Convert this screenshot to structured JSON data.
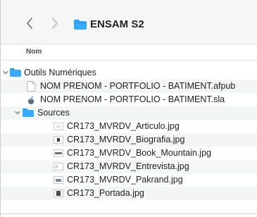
{
  "window": {
    "title": "ENSAM S2",
    "nav": {
      "back_icon": "chevron-left-icon",
      "forward_icon": "chevron-right-icon"
    }
  },
  "columns": {
    "name_header": "Nom"
  },
  "tree": [
    {
      "label": "Outils Numériques",
      "kind": "folder",
      "expanded": true,
      "level": 0
    },
    {
      "label": "NOM PRENOM - PORTFOLIO - BATIMENT.afpub",
      "kind": "file-afpub",
      "level": 1
    },
    {
      "label": "NOM PRENOM - PORTFOLIO - BATIMENT.sla",
      "kind": "file-sla",
      "level": 1
    },
    {
      "label": "Sources",
      "kind": "folder",
      "expanded": true,
      "level": 1
    },
    {
      "label": "CR173_MVRDV_Articulo.jpg",
      "kind": "image",
      "level": 2
    },
    {
      "label": "CR173_MVRDV_Biografia.jpg",
      "kind": "image",
      "level": 2
    },
    {
      "label": "CR173_MVRDV_Book_Mountain.jpg",
      "kind": "image",
      "level": 2
    },
    {
      "label": "CR173_MVRDV_Entrevista.jpg",
      "kind": "image",
      "level": 2
    },
    {
      "label": "CR173_MVRDV_Pakrand.jpg",
      "kind": "image",
      "level": 2
    },
    {
      "label": "CR173_Portada.jpg",
      "kind": "image",
      "level": 2
    }
  ],
  "colors": {
    "folder_blue": "#37a8fa",
    "row_stripe": "#f4f5f5",
    "toolbar_bg": "#f6f6f6"
  }
}
